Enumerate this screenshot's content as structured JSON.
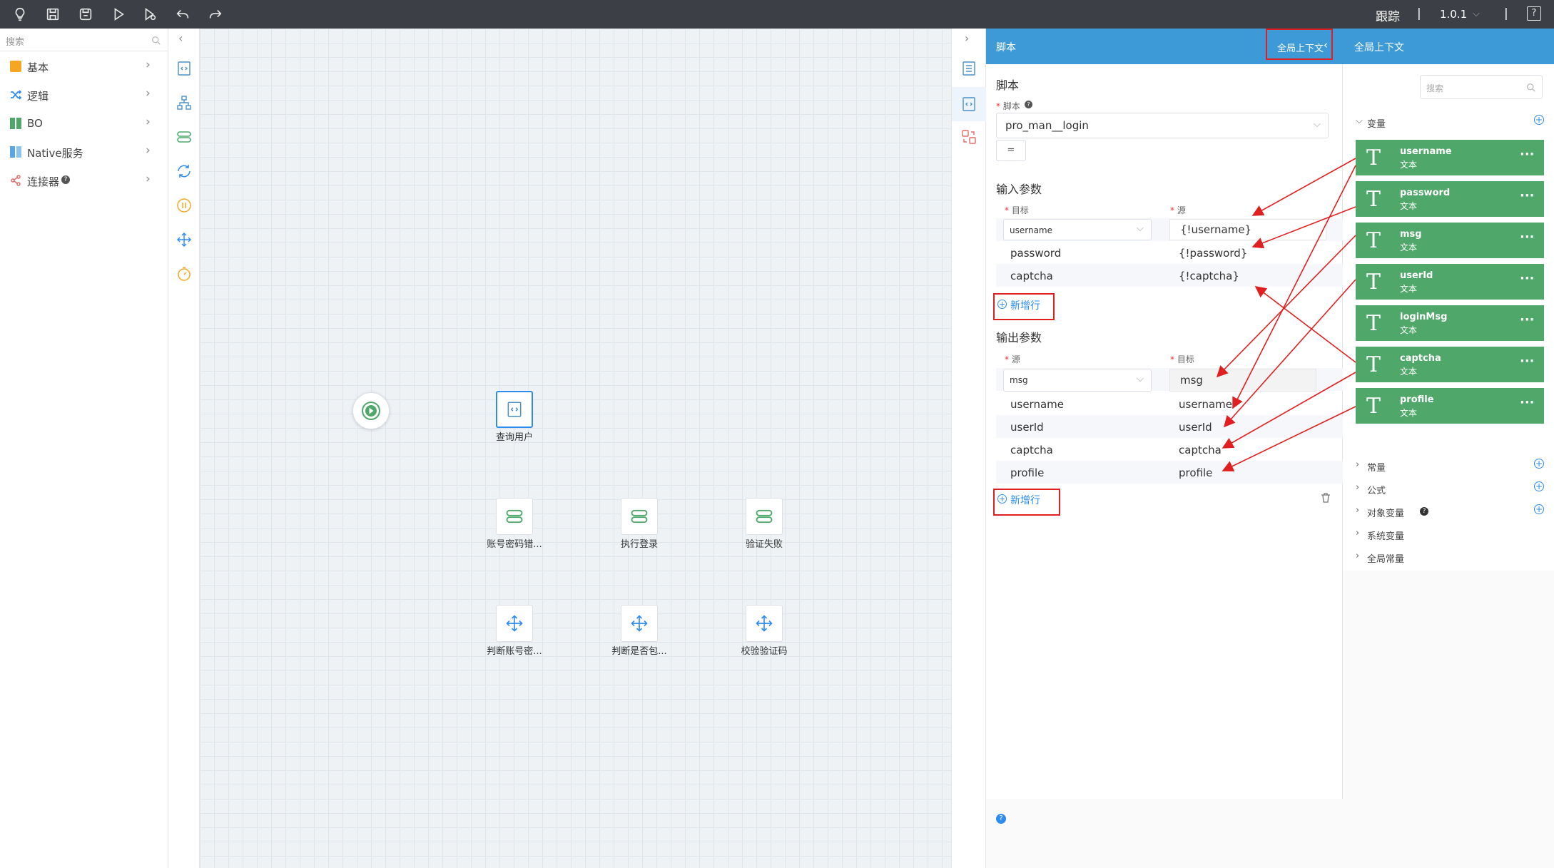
{
  "topbar": {
    "trace_label": "跟踪",
    "sep": "|",
    "version": "1.0.1",
    "help": "?"
  },
  "left": {
    "search_placeholder": "搜索",
    "items": [
      {
        "label": "基本",
        "color": "#f5a623"
      },
      {
        "label": "逻辑",
        "color": "#2d8cf0"
      },
      {
        "label": "BO",
        "color": "#4fa86a"
      },
      {
        "label": "Native服务",
        "color": "#59a5e8"
      },
      {
        "label": "连接器",
        "color": "#e86a6a"
      }
    ]
  },
  "canvas": {
    "nodes": {
      "query_user": "查询用户",
      "account_check": "账号密码错...",
      "do_login": "执行登录",
      "verify_fail": "验证失败",
      "judge_account": "判断账号密...",
      "judge_contains": "判断是否包...",
      "verify_captcha": "校验验证码"
    }
  },
  "script_panel": {
    "header": "脚本",
    "global_ctx_btn": "全局上下文",
    "section_script": "脚本",
    "script_label": "脚本",
    "script_value": "pro_man__login",
    "eq_btn": "=",
    "section_input": "输入参数",
    "col_target": "目标",
    "col_source": "源",
    "input_rows": [
      {
        "target": "username",
        "source": "{!username}"
      },
      {
        "target": "password",
        "source": "{!password}"
      },
      {
        "target": "captcha",
        "source": "{!captcha}"
      }
    ],
    "add_row": "新增行",
    "section_output": "输出参数",
    "out_col_source": "源",
    "out_col_target": "目标",
    "output_rows": [
      {
        "source": "msg",
        "target": "msg"
      },
      {
        "source": "username",
        "target": "username"
      },
      {
        "source": "userId",
        "target": "userId"
      },
      {
        "source": "captcha",
        "target": "captcha"
      },
      {
        "source": "profile",
        "target": "profile"
      }
    ],
    "add_row_out": "新增行"
  },
  "ctx_panel": {
    "header": "全局上下文",
    "search_placeholder": "搜索",
    "variables_label": "变量",
    "variables": [
      {
        "name": "username",
        "type": "文本"
      },
      {
        "name": "password",
        "type": "文本"
      },
      {
        "name": "msg",
        "type": "文本"
      },
      {
        "name": "userId",
        "type": "文本"
      },
      {
        "name": "loginMsg",
        "type": "文本"
      },
      {
        "name": "captcha",
        "type": "文本"
      },
      {
        "name": "profile",
        "type": "文本"
      }
    ],
    "tree": [
      "常量",
      "公式",
      "对象变量",
      "系统变量",
      "全局常量"
    ],
    "var_glyph": "T",
    "dots": "···"
  }
}
